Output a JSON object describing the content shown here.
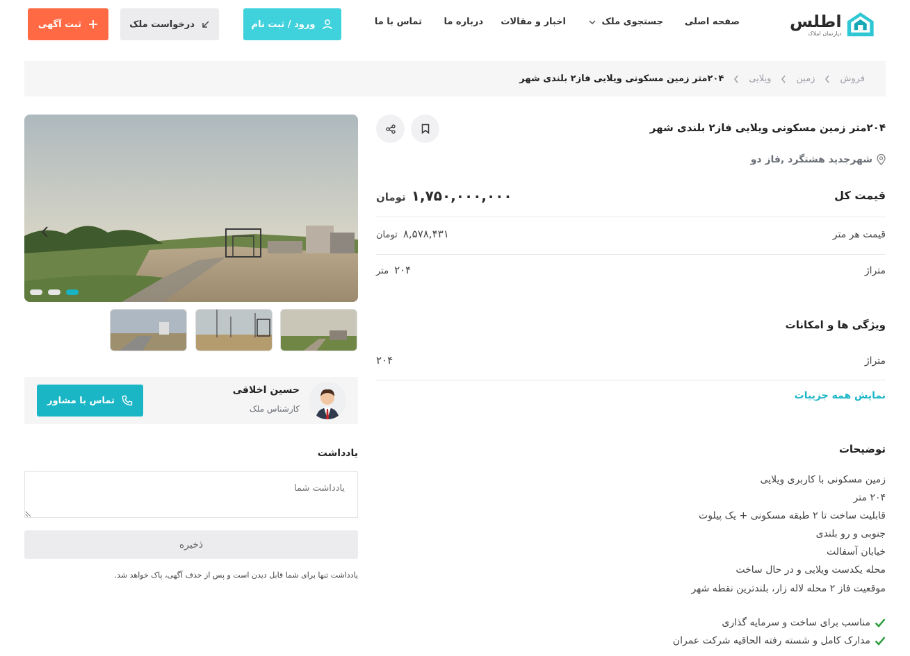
{
  "header": {
    "logo_main": "اطلس",
    "logo_sub": "دپارتمان املاک",
    "nav": [
      "صفحه اصلی",
      "جستجوی ملک",
      "اخبار و مقالات",
      "درباره ما",
      "تماس با ما"
    ],
    "login_label": "ورود / ثبت نام",
    "request_label": "درخواست ملک",
    "add_label": "ثبت آگهی"
  },
  "breadcrumb": {
    "items": [
      "فروش",
      "زمین",
      "ویلایی"
    ],
    "current": "۲۰۴متر زمین مسکونی ویلایی فاز۲ بلندی شهر"
  },
  "listing": {
    "title": "۲۰۴متر زمین مسکونی ویلایی فاز۲ بلندی شهر",
    "location": "شهرجدید هشتگرد ,فاز دو",
    "total_price_label": "قیمت کل",
    "total_price": "۱,۷۵۰,۰۰۰,۰۰۰",
    "currency": "تومان",
    "price_per_meter_label": "قیمت هر متر",
    "price_per_meter": "۸,۵۷۸,۴۳۱",
    "area_label": "متراژ",
    "area_value": "۲۰۴",
    "area_unit": "متر"
  },
  "features": {
    "title": "ویژگی ها و امکانات",
    "rows": [
      {
        "label": "متراژ",
        "value": "۲۰۴"
      }
    ],
    "show_all": "نمایش همه جزییات"
  },
  "description": {
    "title": "توضیحات",
    "lines": [
      "زمین مسکونی با کاربری ویلایی",
      "۲۰۴ متر",
      "قابلیت ساخت تا ۲ طبقه مسکونی + یک پیلوت",
      "جنوبی و رو بلندی",
      "خیابان آسفالت",
      "محله یکدست ویلایی و در حال ساخت",
      "موقعیت فاز ۲ محله لاله زار، بلندترین نقطه شهر"
    ],
    "checks": [
      "مناسب برای ساخت و سرمایه گذاری",
      "مدارک کامل و شسته رفته الحاقیه شرکت عمران"
    ]
  },
  "gallery": {
    "slides_count": 3,
    "active_slide": 3
  },
  "agent": {
    "name": "حسین اخلاقی",
    "role": "کارشناس ملک",
    "call_label": "تماس با مشاور"
  },
  "note": {
    "title": "یادداشت",
    "placeholder": "یادداشت شما",
    "save_label": "ذخیره",
    "hint": "یادداشت تنها برای شما قابل دیدن است و پس از حذف آگهی، پاک خواهد شد."
  },
  "colors": {
    "accent": "#1ab6c6",
    "login": "#3fd1dc",
    "add": "#ff6a45"
  }
}
